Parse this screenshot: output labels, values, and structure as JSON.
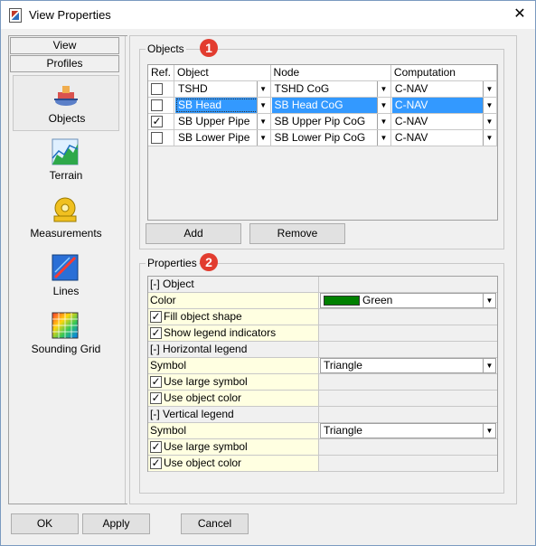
{
  "window": {
    "title": "View Properties",
    "close": "✕"
  },
  "nav": {
    "tabs": [
      "View",
      "Profiles"
    ],
    "items": [
      {
        "label": "Objects",
        "icon": "objects-icon",
        "selected": true
      },
      {
        "label": "Terrain",
        "icon": "terrain-icon"
      },
      {
        "label": "Measurements",
        "icon": "measurements-icon"
      },
      {
        "label": "Lines",
        "icon": "lines-icon"
      },
      {
        "label": "Sounding Grid",
        "icon": "sounding-grid-icon"
      }
    ]
  },
  "objects": {
    "group_title": "Objects",
    "badge": "1",
    "columns": [
      "Ref.",
      "Object",
      "Node",
      "Computation"
    ],
    "rows": [
      {
        "ref": false,
        "object": "TSHD",
        "node": "TSHD CoG",
        "computation": "C-NAV"
      },
      {
        "ref": false,
        "object": "SB Head",
        "node": "SB Head CoG",
        "computation": "C-NAV",
        "selected": true
      },
      {
        "ref": true,
        "object": "SB Upper Pipe",
        "node": "SB Upper Pip CoG",
        "computation": "C-NAV"
      },
      {
        "ref": false,
        "object": "SB Lower Pipe",
        "node": "SB Lower Pip CoG",
        "computation": "C-NAV"
      }
    ],
    "add_label": "Add",
    "remove_label": "Remove"
  },
  "properties": {
    "group_title": "Properties",
    "badge": "2",
    "rows": [
      {
        "kind": "category",
        "label": "[-] Object"
      },
      {
        "kind": "combo",
        "label": "Color",
        "value": "Green",
        "swatch": "#008000"
      },
      {
        "kind": "check",
        "label": "Fill object shape",
        "checked": true
      },
      {
        "kind": "check",
        "label": "Show legend indicators",
        "checked": true
      },
      {
        "kind": "category",
        "label": "[-] Horizontal legend"
      },
      {
        "kind": "combo",
        "label": "Symbol",
        "value": "Triangle"
      },
      {
        "kind": "check",
        "label": "Use large symbol",
        "checked": true
      },
      {
        "kind": "check",
        "label": "Use object color",
        "checked": true
      },
      {
        "kind": "category",
        "label": "[-] Vertical legend"
      },
      {
        "kind": "combo",
        "label": "Symbol",
        "value": "Triangle"
      },
      {
        "kind": "check",
        "label": "Use large symbol",
        "checked": true
      },
      {
        "kind": "check",
        "label": "Use object color",
        "checked": true
      }
    ]
  },
  "footer": {
    "ok": "OK",
    "apply": "Apply",
    "cancel": "Cancel"
  }
}
